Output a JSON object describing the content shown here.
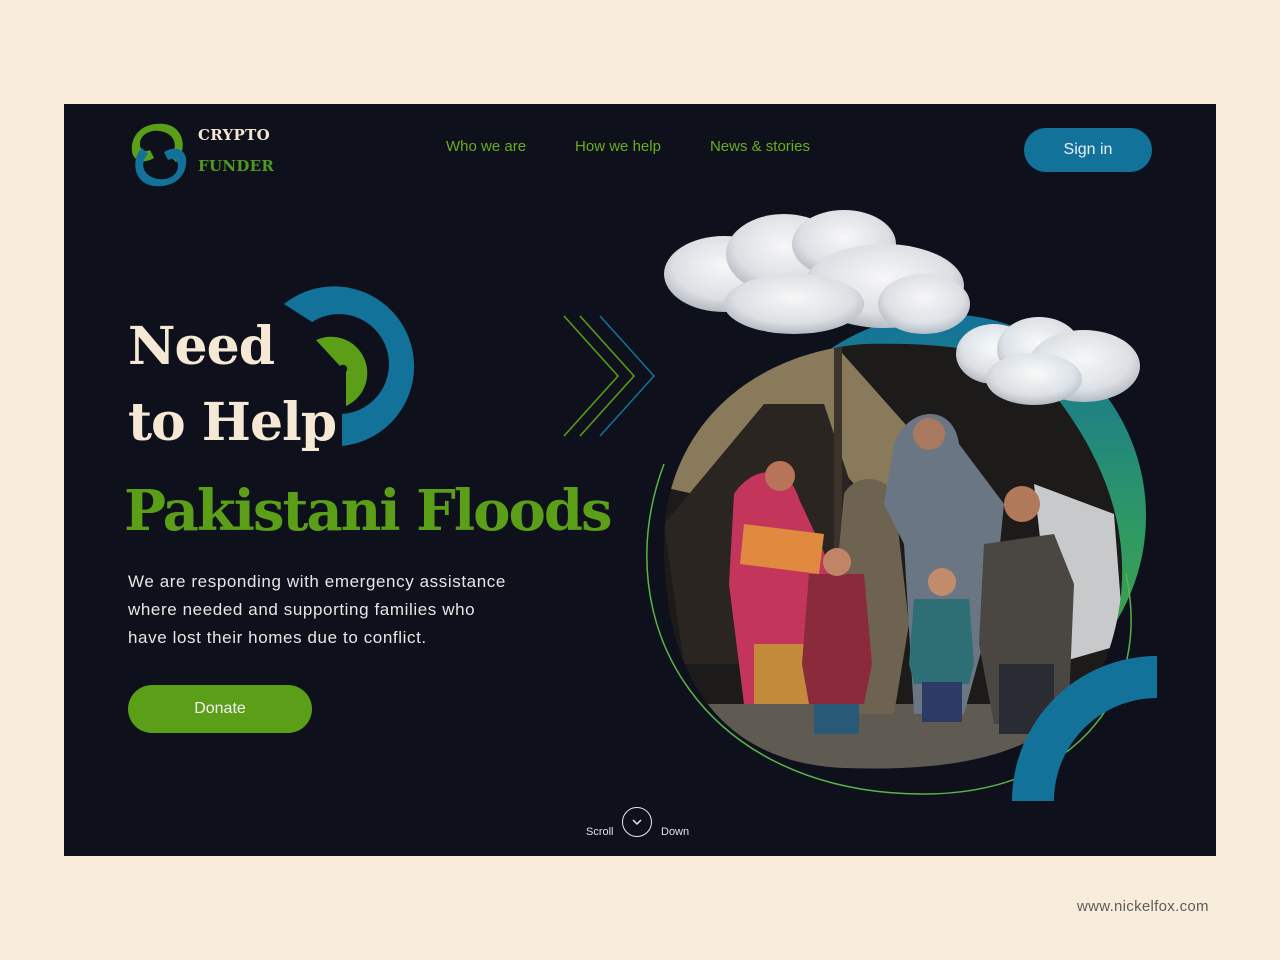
{
  "brand": {
    "line1": "CRYPTO",
    "line2": "FUNDER"
  },
  "nav": {
    "items": [
      {
        "label": "Who we are"
      },
      {
        "label": "How we help"
      },
      {
        "label": "News & stories"
      }
    ],
    "signin_label": "Sign in"
  },
  "hero": {
    "heading_line1": "Need",
    "heading_line2": "to Help",
    "highlight": "Pakistani Floods",
    "description_lines": [
      "We are responding with emergency assistance",
      "where needed and supporting families who",
      "have lost their homes due to conflict."
    ],
    "donate_label": "Donate"
  },
  "scroll": {
    "left": "Scroll",
    "right": "Down",
    "icon": "chevron-down-icon"
  },
  "footer": {
    "credit": "www.nickelfox.com"
  },
  "colors": {
    "background": "#f8ecdb",
    "frame": "#0e111b",
    "green": "#5a9f17",
    "blue": "#13729a",
    "cream": "#f5e8d4"
  }
}
